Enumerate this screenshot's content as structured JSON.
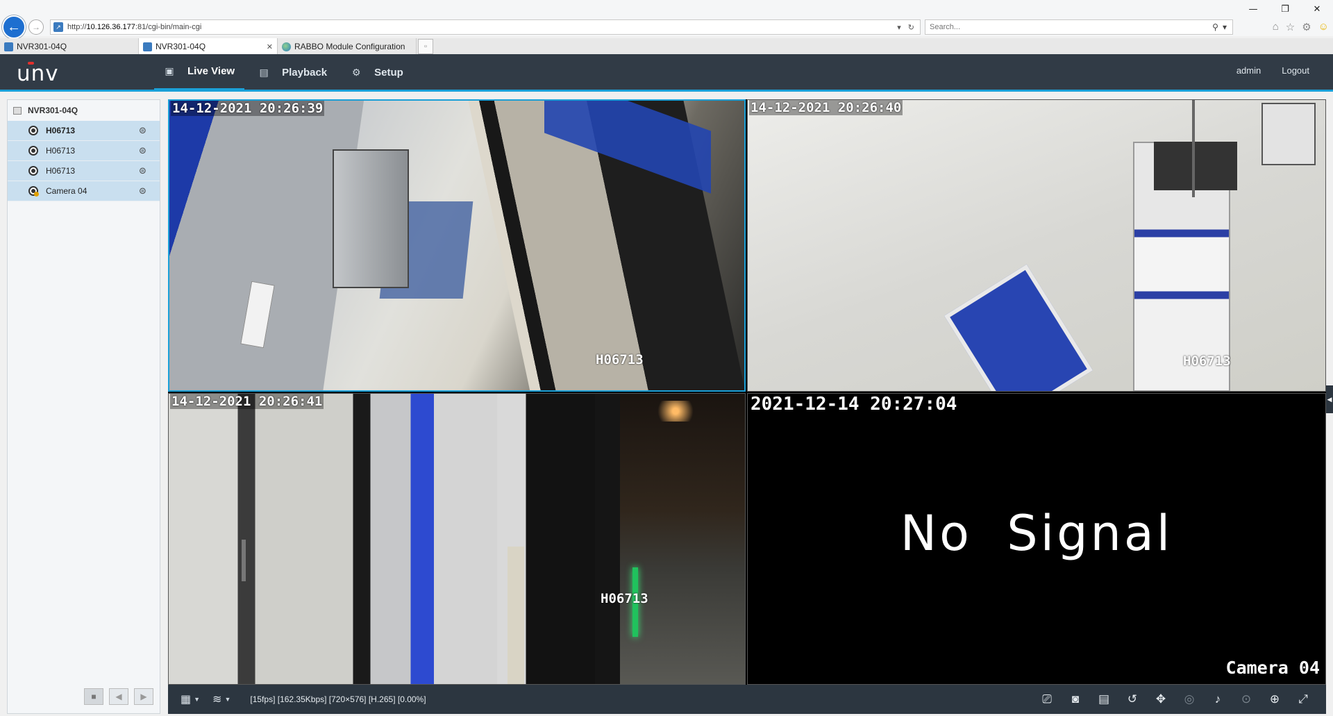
{
  "browser": {
    "url_prefix": "http://",
    "url_host": "10.126.36.177",
    "url_rest": ":81/cgi-bin/main-cgi",
    "search_placeholder": "Search...",
    "window_controls": [
      "—",
      "❐",
      "✕"
    ],
    "tabs": [
      {
        "label": "NVR301-04Q",
        "active": false,
        "closable": false
      },
      {
        "label": "NVR301-04Q",
        "active": true,
        "closable": true
      },
      {
        "label": "RABBO Module Configuration",
        "active": false,
        "closable": false
      }
    ]
  },
  "app": {
    "logo": "unv",
    "nav": [
      {
        "label": "Live View",
        "icon": "monitor-icon",
        "active": true
      },
      {
        "label": "Playback",
        "icon": "film-icon",
        "active": false
      },
      {
        "label": "Setup",
        "icon": "gear-icon",
        "active": false
      }
    ],
    "user": "admin",
    "logout": "Logout"
  },
  "sidebar": {
    "root": "NVR301-04Q",
    "devices": [
      {
        "label": "H06713",
        "selected": true
      },
      {
        "label": "H06713",
        "selected": false
      },
      {
        "label": "H06713",
        "selected": false
      },
      {
        "label": "Camera 04",
        "selected": false,
        "warning": true
      }
    ]
  },
  "panes": [
    {
      "timestamp": "14-12-2021  20:26:39",
      "name": "H06713"
    },
    {
      "timestamp": "14-12-2021  20:26:40",
      "name": "H06713"
    },
    {
      "timestamp": "14-12-2021  20:26:41",
      "name": "H06713"
    },
    {
      "timestamp": "2021-12-14  20:27:04",
      "name": "Camera  04",
      "message": "No Signal"
    }
  ],
  "bottom_bar": {
    "stream_info": "[15fps] [162.35Kbps] [720×576] [H.265] [0.00%]"
  },
  "colors": {
    "header_bg": "#313b46",
    "accent": "#1aa0d8",
    "sidebar_selected": "#c9dfef"
  }
}
